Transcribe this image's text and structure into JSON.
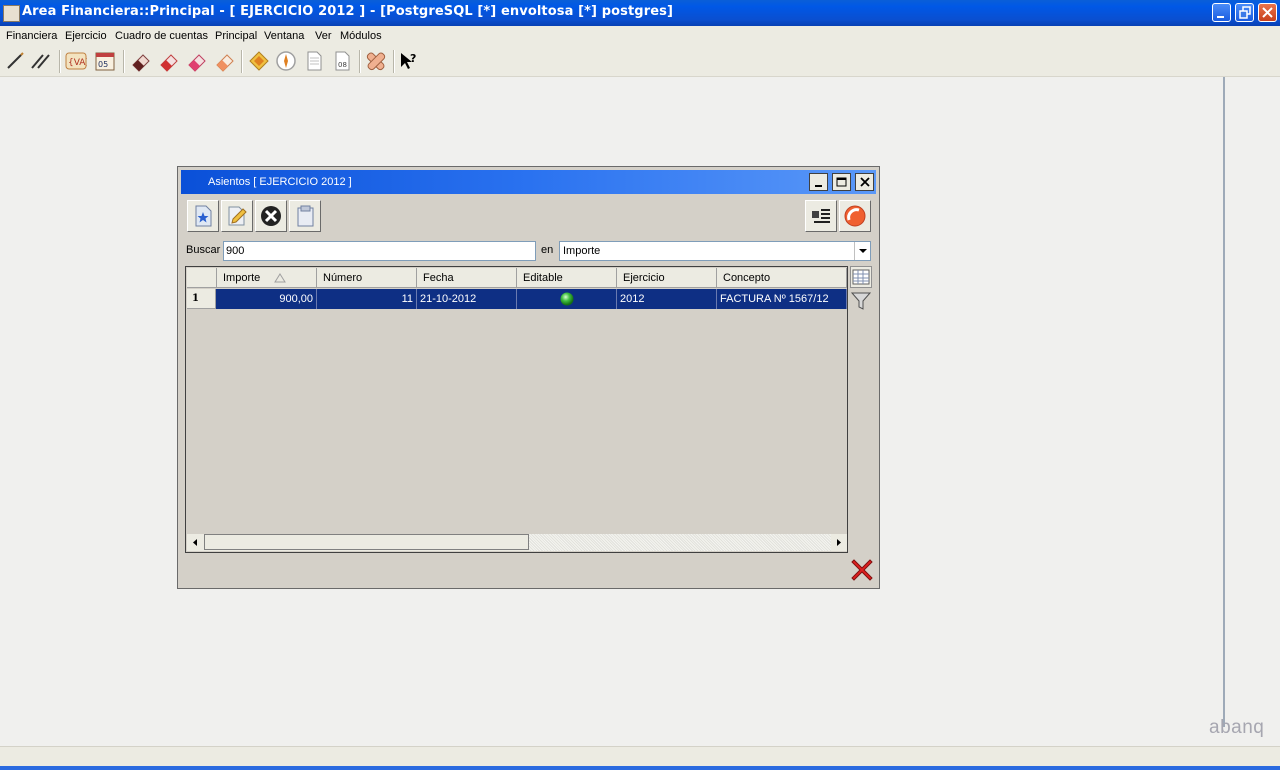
{
  "app": {
    "title": "Area Financiera::Principal  - [ EJERCICIO 2012 ] - [PostgreSQL [*] envoltosa [*] postgres]"
  },
  "menu": [
    "Financiera",
    "Ejercicio",
    "Cuadro de cuentas",
    "Principal",
    "Ventana",
    "Ver",
    "Módulos"
  ],
  "toolbar": {
    "icons": [
      "diario-icon",
      "mayor-icon",
      "iva-icon",
      "calendario-icon",
      "goma-1-icon",
      "goma-2-icon",
      "goma-3-icon",
      "goma-4-icon",
      "diamante-icon",
      "brujula-icon",
      "documento-icon",
      "documento-08-icon",
      "tiritas-icon",
      "ayuda-cursor-icon"
    ]
  },
  "child_window": {
    "title": "Asientos [ EJERCICIO 2012 ]",
    "search": {
      "label": "Buscar",
      "value": "900",
      "en_label": "en",
      "field": "Importe"
    },
    "table": {
      "columns": [
        "Importe",
        "Número",
        "Fecha",
        "Editable",
        "Ejercicio",
        "Concepto"
      ],
      "sort_column": "Importe",
      "rows": [
        {
          "row_number": "1",
          "importe": "900,00",
          "numero": "11",
          "fecha": "21-10-2012",
          "editable": true,
          "ejercicio": "2012",
          "concepto": "FACTURA Nº 1567/12"
        }
      ]
    }
  },
  "watermark": "abanq",
  "colors": {
    "titlebar": "#0a4fd0",
    "selection": "#0e2f84",
    "editable_ok": "#2ea82e"
  }
}
